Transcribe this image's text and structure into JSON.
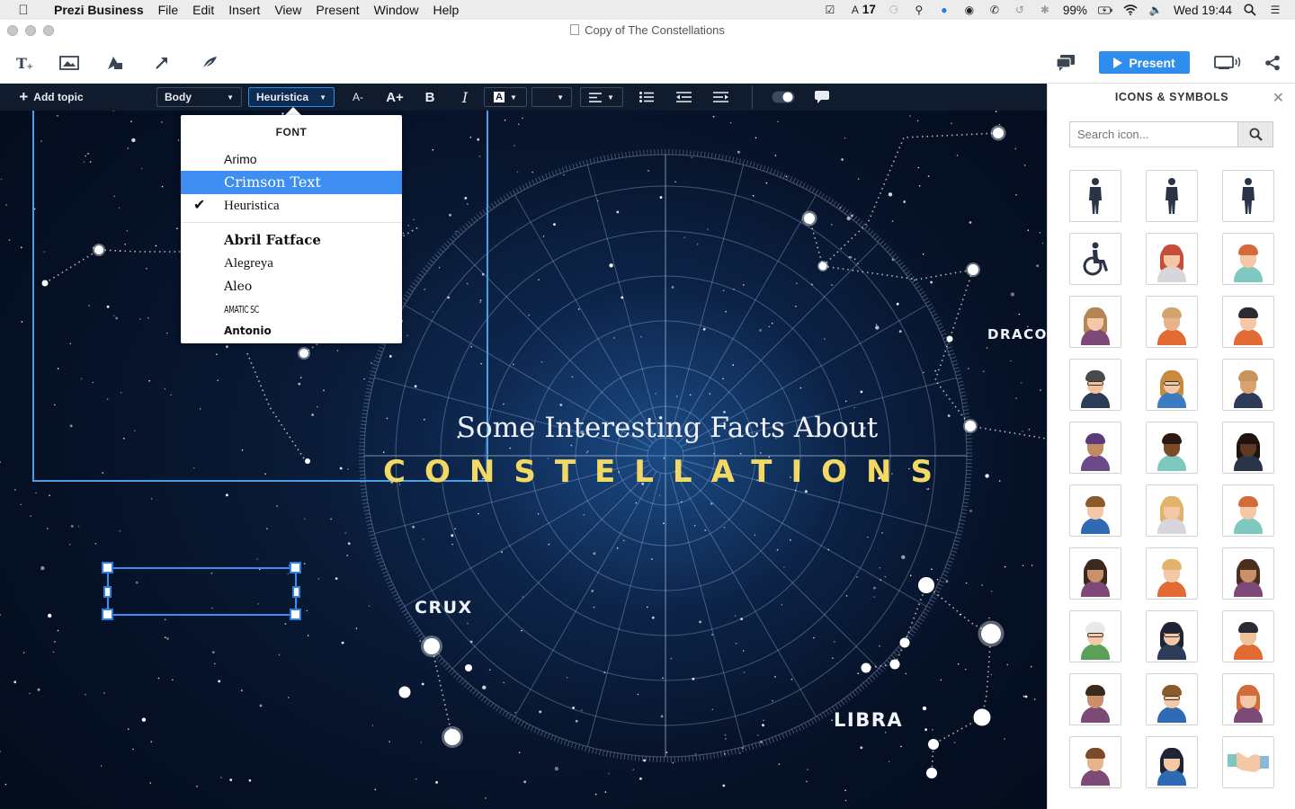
{
  "menubar": {
    "app": "Prezi Business",
    "items": [
      "File",
      "Edit",
      "Insert",
      "View",
      "Present",
      "Window",
      "Help"
    ],
    "status": {
      "badge_count": "17",
      "battery": "99%",
      "clock": "Wed 19:44"
    }
  },
  "window": {
    "title": "Copy of The Constellations"
  },
  "toolbar": {
    "present_label": "Present"
  },
  "text_toolbar": {
    "add_topic": "Add topic",
    "style_value": "Body",
    "font_value": "Heuristica",
    "decrease_size": "A-",
    "increase_size": "A+",
    "bold": "B",
    "italic": "I",
    "color_letter": "A"
  },
  "font_dropdown": {
    "header": "FONT",
    "options_top": [
      "Arimo",
      "Crimson Text",
      "Heuristica"
    ],
    "highlighted": "Crimson Text",
    "checked": "Heuristica",
    "options_more": [
      "Abril Fatface",
      "Alegreya",
      "Aleo",
      "AMATIC SC",
      "Antonio"
    ]
  },
  "canvas": {
    "subtitle": "Some Interesting Facts About",
    "title": "CONSTELLATIONS",
    "labels": {
      "crux": "CRUX",
      "libra": "LIBRA",
      "draco": "DRACO"
    }
  },
  "panel": {
    "title": "ICONS & SYMBOLS",
    "search_placeholder": "Search icon...",
    "icons": [
      "man-standing-icon",
      "businessman-icon",
      "man-walking-icon",
      "wheelchair-user-icon",
      "woman-redhead-icon",
      "man-red-beard-icon",
      "woman-avatar-icon",
      "bald-man-avatar-icon",
      "woman-headset-icon",
      "bearded-man-icon",
      "woman-glasses-icon",
      "superhero-man-icon",
      "punk-woman-icon",
      "dark-skinned-man-icon",
      "dark-skinned-woman-icon",
      "young-man-icon",
      "blonde-woman-icon",
      "ginger-man-icon",
      "curly-woman-icon",
      "blonde-man-icon",
      "brunette-woman-icon",
      "old-man-glasses-icon",
      "woman-dark-hair-icon",
      "man-beanie-icon",
      "man-laptop-icon",
      "man-glasses-icon",
      "redhead-woman-icon",
      "brown-hair-man-icon",
      "superhero-woman-icon",
      "handshake-icon"
    ]
  },
  "colors": {
    "accent": "#2f8ded",
    "title_gold": "#f2d964",
    "toolbar_dark": "#101b2d",
    "dropdown_highlight": "#3d8ef0"
  }
}
